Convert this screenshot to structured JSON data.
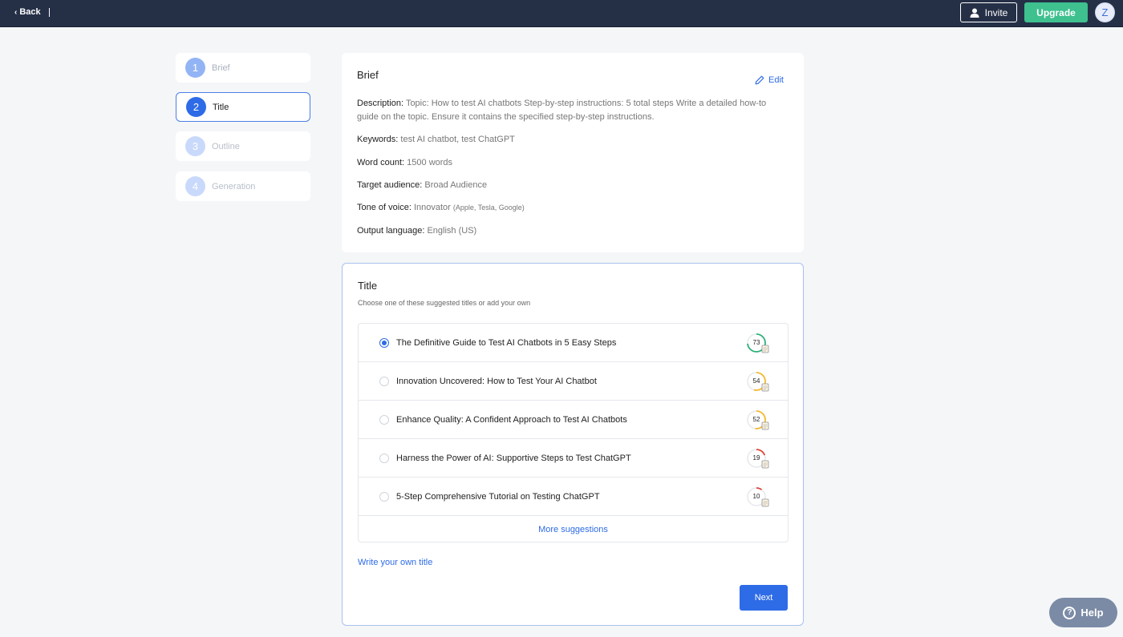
{
  "topbar": {
    "back_label": "Back",
    "invite_label": "Invite",
    "upgrade_label": "Upgrade",
    "avatar_initial": "Z"
  },
  "steps": [
    {
      "num": "1",
      "label": "Brief"
    },
    {
      "num": "2",
      "label": "Title"
    },
    {
      "num": "3",
      "label": "Outline"
    },
    {
      "num": "4",
      "label": "Generation"
    }
  ],
  "brief": {
    "title": "Brief",
    "edit_label": "Edit",
    "description_label": "Description:",
    "description_value": "Topic: How to test AI chatbots Step-by-step instructions: 5 total steps Write a detailed how-to guide on the topic. Ensure it contains the specified step-by-step instructions.",
    "keywords_label": "Keywords:",
    "keywords_value": "test AI chatbot, test ChatGPT",
    "wordcount_label": "Word count:",
    "wordcount_value": "1500 words",
    "audience_label": "Target audience:",
    "audience_value": "Broad Audience",
    "tone_label": "Tone of voice:",
    "tone_value": "Innovator",
    "tone_examples": "(Apple, Tesla, Google)",
    "language_label": "Output language:",
    "language_value": "English (US)"
  },
  "title_section": {
    "title": "Title",
    "subtitle": "Choose one of these suggested titles or add your own",
    "suggestions": [
      {
        "text": "The Definitive Guide to Test AI Chatbots in 5 Easy Steps",
        "score": "73",
        "selected": true,
        "color": "#2fb07a"
      },
      {
        "text": "Innovation Uncovered: How to Test Your AI Chatbot",
        "score": "54",
        "selected": false,
        "color": "#f2b92b"
      },
      {
        "text": "Enhance Quality: A Confident Approach to Test AI Chatbots",
        "score": "52",
        "selected": false,
        "color": "#f2b92b"
      },
      {
        "text": "Harness the Power of AI: Supportive Steps to Test ChatGPT",
        "score": "19",
        "selected": false,
        "color": "#e0473c"
      },
      {
        "text": "5-Step Comprehensive Tutorial on Testing ChatGPT",
        "score": "10",
        "selected": false,
        "color": "#e0473c"
      }
    ],
    "more_label": "More suggestions",
    "own_label": "Write your own title",
    "next_label": "Next"
  },
  "help_label": "Help",
  "colors": {
    "topbar": "#253047",
    "accent": "#2e6be6",
    "upgrade": "#3ec08f"
  }
}
